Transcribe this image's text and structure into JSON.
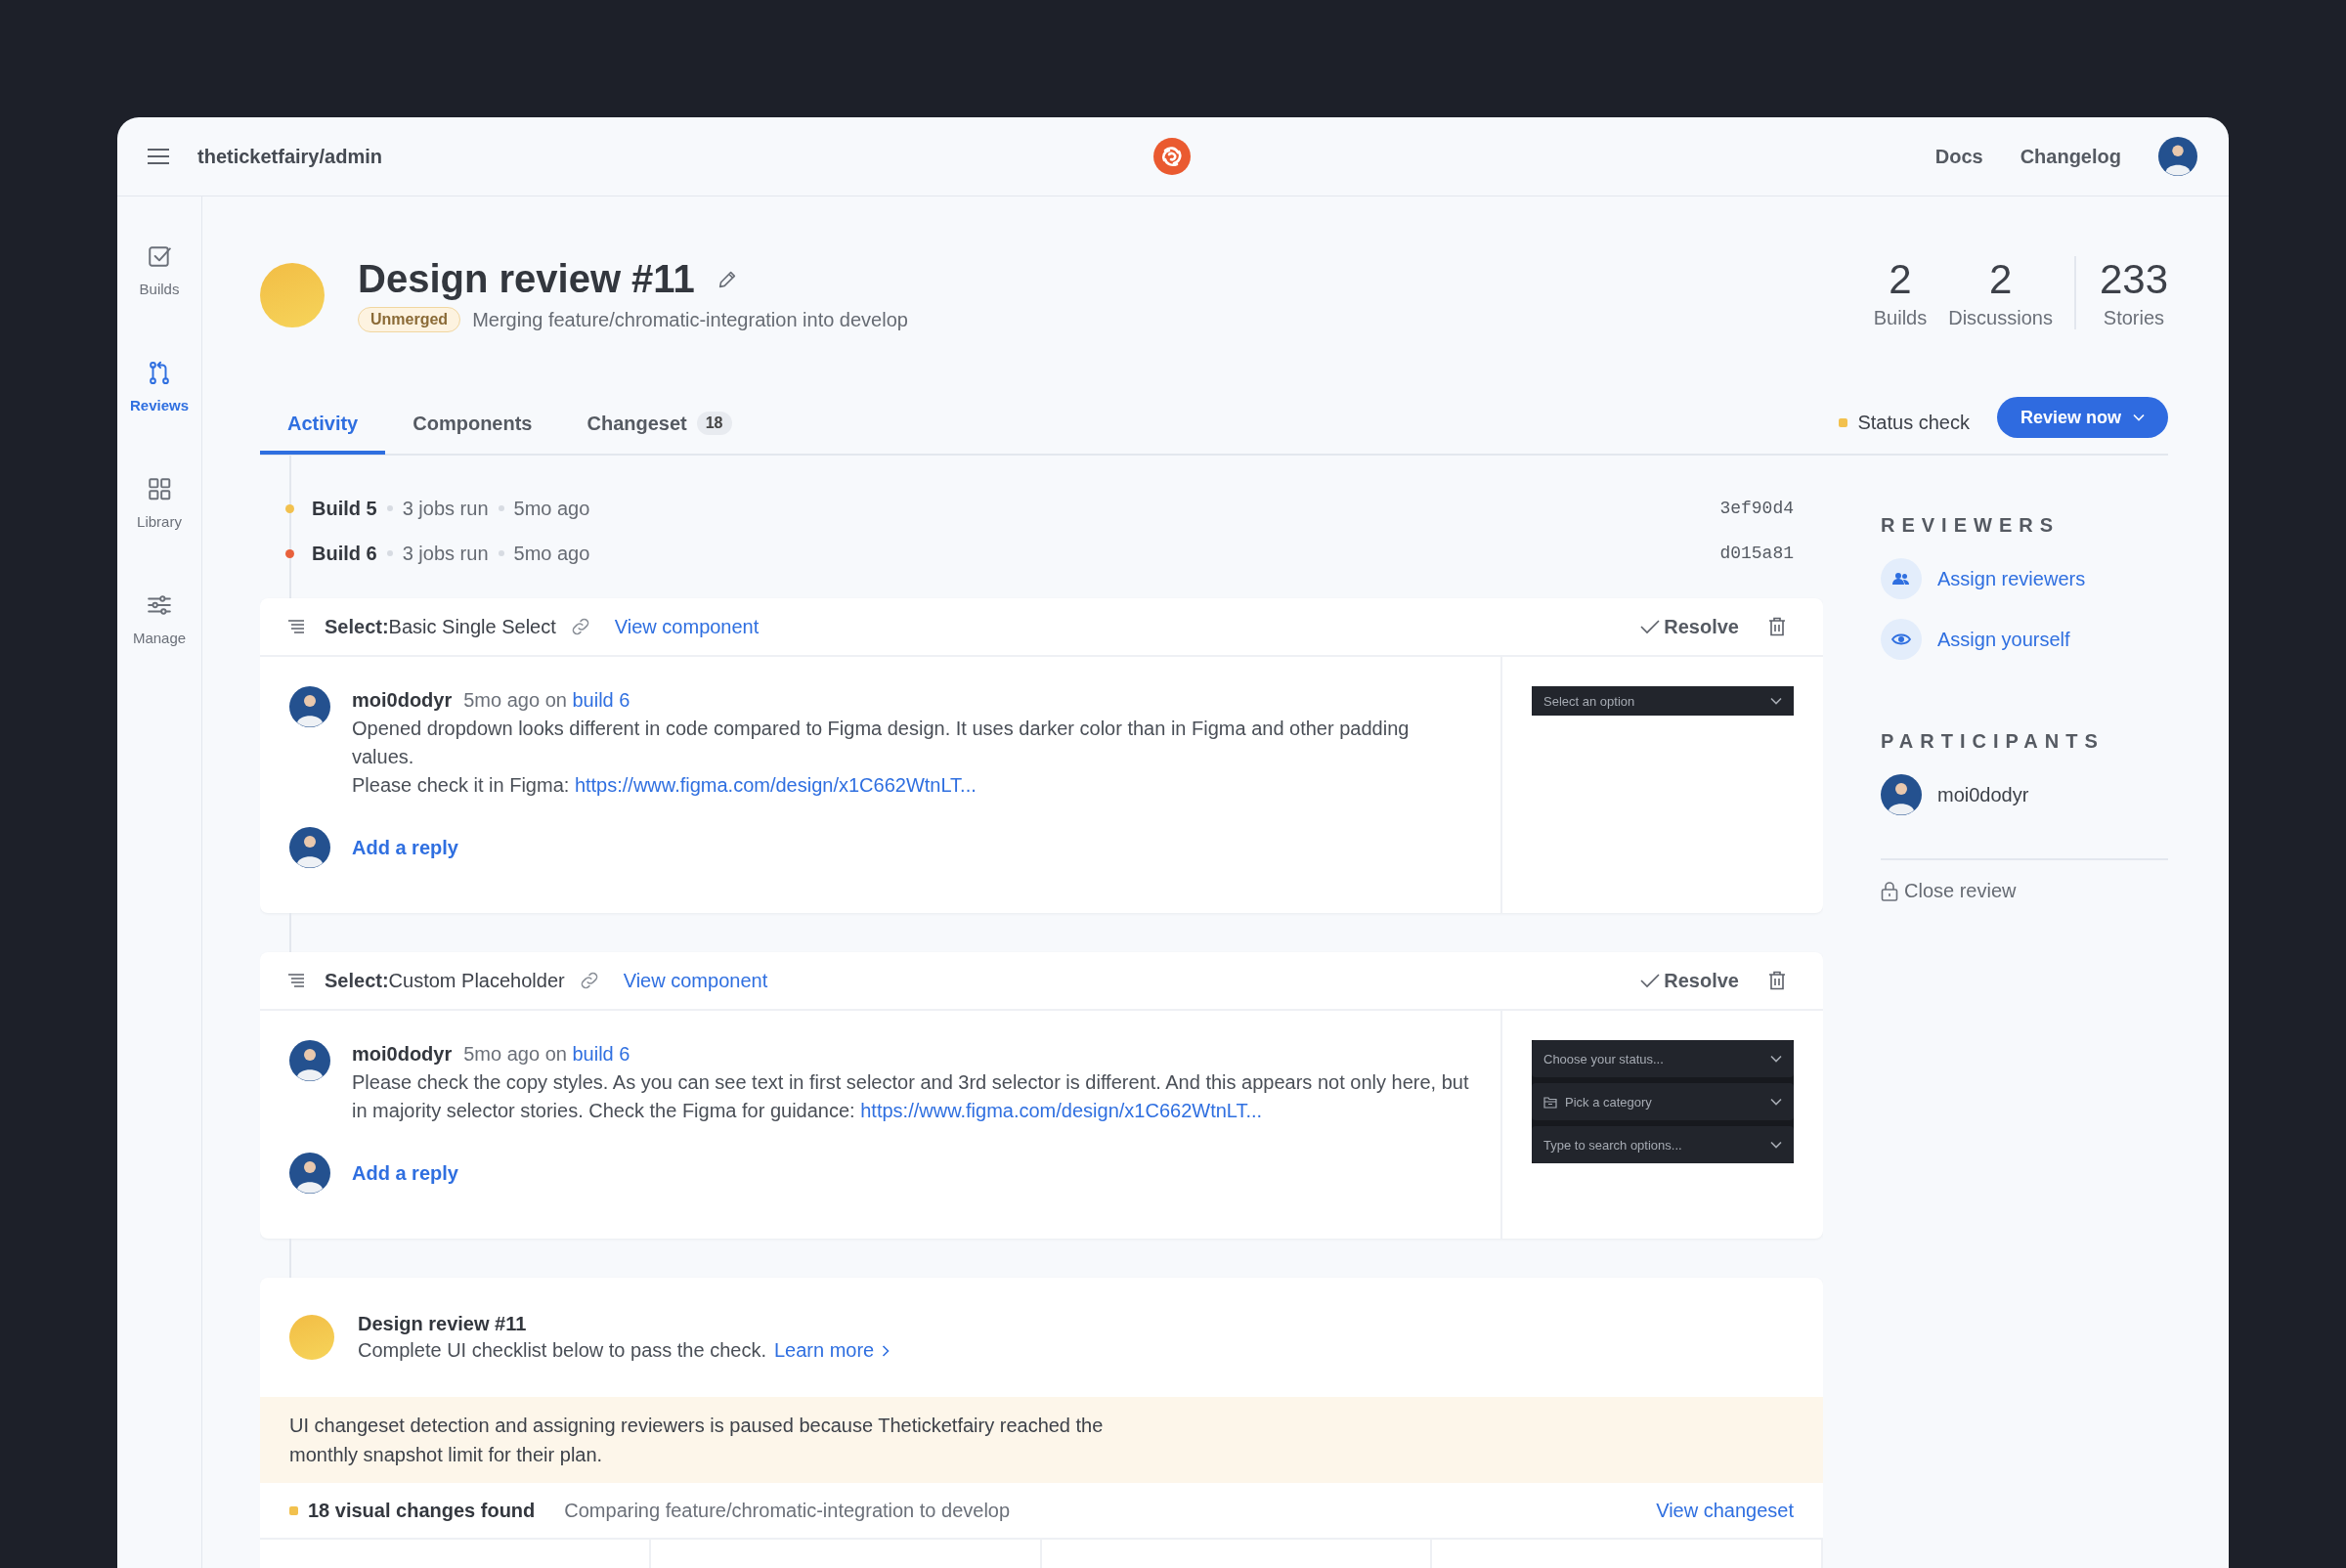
{
  "header": {
    "repo": "theticketfairy/admin",
    "links": [
      "Docs",
      "Changelog"
    ]
  },
  "sidebar": {
    "items": [
      {
        "label": "Builds",
        "kind": "builds",
        "selected": false
      },
      {
        "label": "Reviews",
        "kind": "reviews",
        "selected": true
      },
      {
        "label": "Library",
        "kind": "library",
        "selected": false
      },
      {
        "label": "Manage",
        "kind": "manage",
        "selected": false
      }
    ]
  },
  "review": {
    "title": "Design review #11",
    "badge": "Unmerged",
    "subtitle": "Merging feature/chromatic-integration into develop",
    "stats": [
      {
        "value": "2",
        "label": "Builds",
        "separated": false
      },
      {
        "value": "2",
        "label": "Discussions",
        "separated": false
      },
      {
        "value": "233",
        "label": "Stories",
        "separated": true
      }
    ]
  },
  "tabs": [
    {
      "label": "Activity",
      "selected": true
    },
    {
      "label": "Components",
      "selected": false
    },
    {
      "label": "Changeset",
      "count": "18",
      "selected": false
    }
  ],
  "status_check": {
    "label": "Status check",
    "color": "#f2c14e"
  },
  "review_button": "Review now",
  "builds": [
    {
      "name": "Build 5",
      "jobs": "3 jobs run",
      "age": "5mo ago",
      "commit": "3ef90d4",
      "color": "#f2c14e"
    },
    {
      "name": "Build 6",
      "jobs": "3 jobs run",
      "age": "5mo ago",
      "commit": "d015a81",
      "color": "#e8613c"
    }
  ],
  "discussions": [
    {
      "component_kind": "Select:",
      "component": "Basic Single Select",
      "view_link": "View component",
      "resolve": "Resolve",
      "comment": {
        "author": "moi0dodyr",
        "age": "5mo ago on",
        "build_link": "build 6",
        "lines": [
          {
            "text": "Opened dropdown looks different in code compared to Figma design. It uses darker color than in Figma and other padding values."
          },
          {
            "text": "Please check it in Figma: ",
            "link": "https://www.figma.com/design/x1C662WtnLT..."
          }
        ]
      },
      "reply": "Add a reply",
      "preview": [
        {
          "text": "Select an option",
          "icon": false
        }
      ]
    },
    {
      "component_kind": "Select:",
      "component": "Custom Placeholder",
      "view_link": "View component",
      "resolve": "Resolve",
      "comment": {
        "author": "moi0dodyr",
        "age": "5mo ago on",
        "build_link": "build 6",
        "lines": [
          {
            "text": "Please check the copy styles. As you can see text in first selector and 3rd selector is different. And this appears not only here, but in majority selector stories. Check the Figma for guidance: ",
            "link": "https://www.figma.com/design/x1C662WtnLT..."
          }
        ]
      },
      "reply": "Add a reply",
      "preview": [
        {
          "text": "Choose your status...",
          "icon": false
        },
        {
          "text": "Pick a category",
          "icon": true
        },
        {
          "text": "Type to search options...",
          "icon": false
        }
      ]
    }
  ],
  "check": {
    "title": "Design review #11",
    "text": "Complete UI checklist below to pass the check.",
    "link": "Learn more",
    "notice": "UI changeset detection and assigning reviewers is paused because Theticketfairy reached the monthly snapshot limit for their plan.",
    "summary": {
      "label": "18 visual changes found",
      "color": "#f2c14e",
      "comparison": "Comparing feature/chromatic-integration to develop",
      "link": "View changeset"
    }
  },
  "reviewers": {
    "title": "REVIEWERS",
    "actions": [
      {
        "label": "Assign reviewers",
        "kind": "people"
      },
      {
        "label": "Assign yourself",
        "kind": "eye"
      }
    ]
  },
  "participants": {
    "title": "PARTICIPANTS",
    "people": [
      {
        "name": "moi0dodyr"
      }
    ]
  },
  "close_review": "Close review"
}
